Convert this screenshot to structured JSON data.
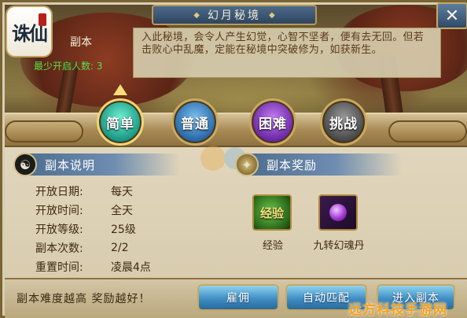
{
  "window": {
    "title": "幻月秘境",
    "close_glyph": "✕"
  },
  "logo": {
    "text": "诛仙"
  },
  "dungeon": {
    "label": "副本",
    "min_players_label": "最少开启人数: 3",
    "description": "入此秘境，会令人产生幻觉，心智不坚者，便有去无回。但若击败心中乱魔，定能在秘境中突破修为，如获新生。"
  },
  "difficulties": [
    {
      "label": "简单",
      "selected": true
    },
    {
      "label": "普通",
      "selected": false
    },
    {
      "label": "困难",
      "selected": false
    },
    {
      "label": "挑战",
      "selected": false
    }
  ],
  "info_section": {
    "title": "副本说明",
    "rows": [
      {
        "key": "开放日期:",
        "value": "每天"
      },
      {
        "key": "开放时间:",
        "value": "全天"
      },
      {
        "key": "开放等级:",
        "value": "25级"
      },
      {
        "key": "副本次数:",
        "value": "2/2"
      },
      {
        "key": "重置时间:",
        "value": "凌晨4点"
      }
    ]
  },
  "reward_section": {
    "title": "副本奖励",
    "items": [
      {
        "icon_text": "经验",
        "label": "经验"
      },
      {
        "icon_text": "",
        "label": "九转幻魂丹"
      }
    ]
  },
  "footer": {
    "tip": "副本难度越高 奖励越好！",
    "buttons": [
      "雇佣",
      "自动匹配",
      "进入副本"
    ]
  },
  "watermark": "远方科技手游网",
  "colors": {
    "accent_blue": "#3f8ec4",
    "gold_border": "#caa85e",
    "green_text": "#59e24a"
  }
}
